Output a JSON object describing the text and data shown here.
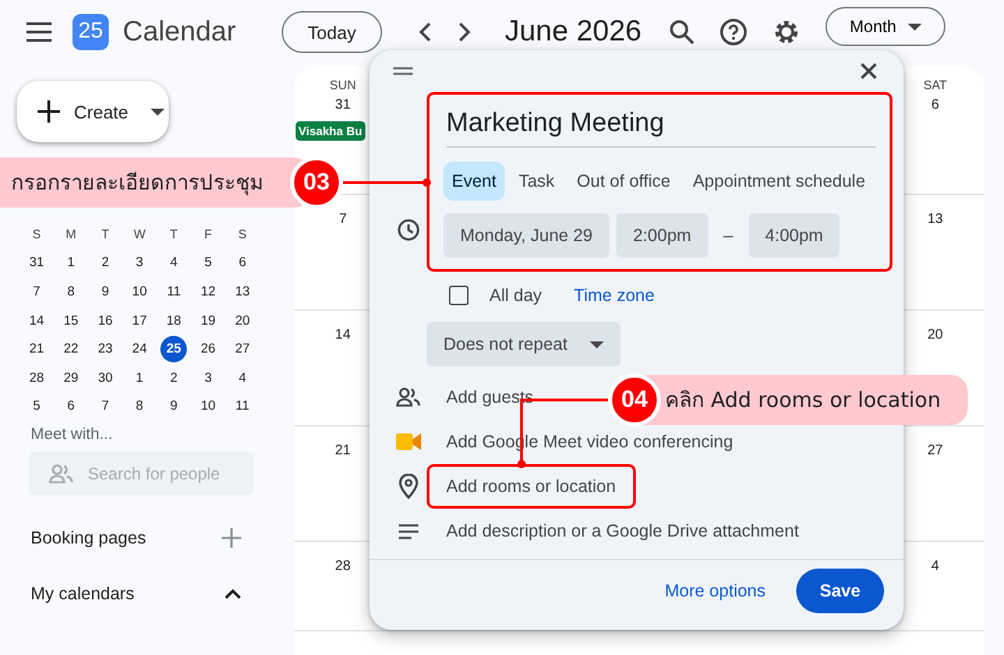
{
  "header": {
    "logo_text": "25",
    "app_name": "Calendar",
    "today_button": "Today",
    "month_title": "June 2026",
    "view_button": "Month"
  },
  "sidebar": {
    "create_button": "Create",
    "mini_calendar": {
      "weekdays": [
        "S",
        "M",
        "T",
        "W",
        "T",
        "F",
        "S"
      ],
      "weeks": [
        [
          {
            "day": "31",
            "selected": false
          },
          {
            "day": "1",
            "selected": false
          },
          {
            "day": "2",
            "selected": false
          },
          {
            "day": "3",
            "selected": false
          },
          {
            "day": "4",
            "selected": false
          },
          {
            "day": "5",
            "selected": false
          },
          {
            "day": "6",
            "selected": false
          }
        ],
        [
          {
            "day": "7",
            "selected": false
          },
          {
            "day": "8",
            "selected": false
          },
          {
            "day": "9",
            "selected": false
          },
          {
            "day": "10",
            "selected": false
          },
          {
            "day": "11",
            "selected": false
          },
          {
            "day": "12",
            "selected": false
          },
          {
            "day": "13",
            "selected": false
          }
        ],
        [
          {
            "day": "14",
            "selected": false
          },
          {
            "day": "15",
            "selected": false
          },
          {
            "day": "16",
            "selected": false
          },
          {
            "day": "17",
            "selected": false
          },
          {
            "day": "18",
            "selected": false
          },
          {
            "day": "19",
            "selected": false
          },
          {
            "day": "20",
            "selected": false
          }
        ],
        [
          {
            "day": "21",
            "selected": false
          },
          {
            "day": "22",
            "selected": false
          },
          {
            "day": "23",
            "selected": false
          },
          {
            "day": "24",
            "selected": false
          },
          {
            "day": "25",
            "selected": true
          },
          {
            "day": "26",
            "selected": false
          },
          {
            "day": "27",
            "selected": false
          }
        ],
        [
          {
            "day": "28",
            "selected": false
          },
          {
            "day": "29",
            "selected": false
          },
          {
            "day": "30",
            "selected": false
          },
          {
            "day": "1",
            "selected": false
          },
          {
            "day": "2",
            "selected": false
          },
          {
            "day": "3",
            "selected": false
          },
          {
            "day": "4",
            "selected": false
          }
        ],
        [
          {
            "day": "5",
            "selected": false
          },
          {
            "day": "6",
            "selected": false
          },
          {
            "day": "7",
            "selected": false
          },
          {
            "day": "8",
            "selected": false
          },
          {
            "day": "9",
            "selected": false
          },
          {
            "day": "10",
            "selected": false
          },
          {
            "day": "11",
            "selected": false
          }
        ]
      ]
    },
    "meet_with": {
      "title": "Meet with...",
      "placeholder": "Search for people"
    },
    "sections": [
      {
        "label": "Booking pages",
        "kind": "add"
      },
      {
        "label": "My calendars",
        "kind": "collapse"
      }
    ]
  },
  "month_grid": {
    "columns": [
      {
        "weekday": "SUN",
        "dates": [
          "31",
          "7",
          "14",
          "21",
          "28"
        ],
        "event": {
          "label": "Visakha Bu",
          "color": "#0b8043"
        }
      },
      {
        "weekday": "SAT",
        "dates": [
          "6",
          "13",
          "20",
          "27",
          "4"
        ]
      }
    ]
  },
  "dialog": {
    "title_value": "Marketing Meeting",
    "tabs": [
      {
        "label": "Event",
        "selected": true
      },
      {
        "label": "Task",
        "selected": false
      },
      {
        "label": "Out of office",
        "selected": false
      },
      {
        "label": "Appointment schedule",
        "selected": false
      }
    ],
    "date": "Monday, June 29",
    "start_time": "2:00pm",
    "separator": "–",
    "end_time": "4:00pm",
    "all_day": {
      "label": "All day",
      "checked": false
    },
    "time_zone_link": "Time zone",
    "repeat": "Does not repeat",
    "options": [
      {
        "kind": "guests",
        "label": "Add guests"
      },
      {
        "kind": "meet",
        "label": "Add Google Meet video conferencing"
      },
      {
        "kind": "location",
        "label": "Add rooms or location"
      },
      {
        "kind": "description",
        "label": "Add description or a Google Drive attachment"
      }
    ],
    "more_options": "More options",
    "save_button": "Save"
  },
  "annotations": [
    {
      "number": "03",
      "text": "กรอกรายละเอียดการประชุม"
    },
    {
      "number": "04",
      "text": "คลิก Add rooms or location"
    }
  ]
}
